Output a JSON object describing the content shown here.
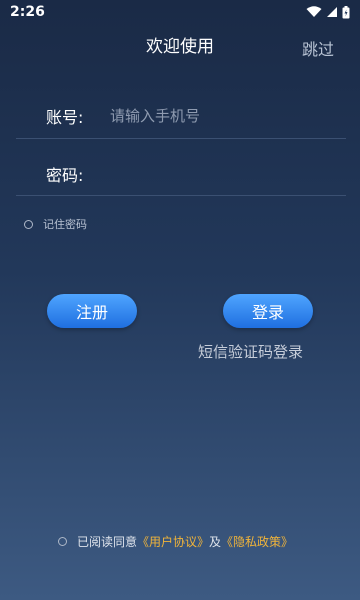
{
  "status": {
    "time": "2:26"
  },
  "header": {
    "title": "欢迎使用",
    "skip": "跳过"
  },
  "form": {
    "account_label": "账号:",
    "account_placeholder": "请输入手机号",
    "password_label": "密码:",
    "remember_label": "记住密码"
  },
  "actions": {
    "register": "注册",
    "login": "登录",
    "sms_login": "短信验证码登录"
  },
  "agreement": {
    "prefix": "已阅读同意",
    "user_agreement": "《用户协议》",
    "and": "及",
    "privacy_policy": "《隐私政策》"
  },
  "colors": {
    "accent": "#2f86f0",
    "link": "#f1b43a"
  }
}
